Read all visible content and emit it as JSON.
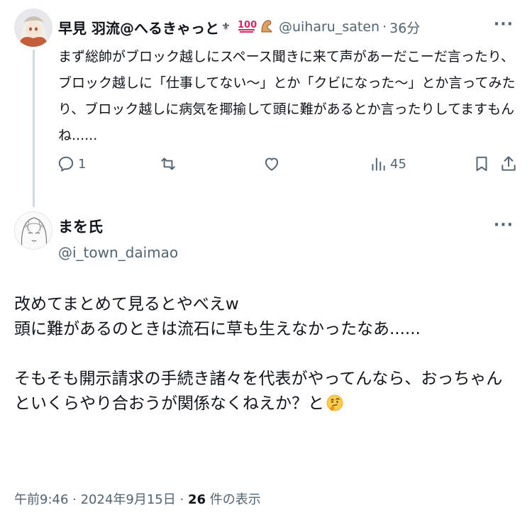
{
  "reply": {
    "name": "早見 羽流@へるきゃっと",
    "emojis": [
      "badge-emoji",
      "hundred-points-emoji",
      "arm-emoji"
    ],
    "handle": "@uiharu_saten",
    "separator": "·",
    "time": "36分",
    "more": "···",
    "text": "まず総帥がブロック越しにスペース聞きに来て声があーだこーだ言ったり、ブロック越しに「仕事してない〜」とか「クビになった〜」とか言ってみたり、ブロック越しに病気を揶揄して頭に難があるとか言ったりしてますもんね......",
    "actions": {
      "reply_count": "1",
      "retweet_count": "",
      "like_count": "",
      "views_count": "45"
    }
  },
  "main": {
    "name": "まを氏",
    "handle": "@i_town_daimao",
    "more": "···",
    "text": "改めてまとめて見るとやべえw\n頭に難があるのときは流石に草も生えなかったなあ......\n\nそもそも開示請求の手続き諸々を代表がやってんなら、おっちゃんといくらやり合おうが関係なくねえか？と",
    "trailing_emoji": "thinking-face-emoji"
  },
  "meta": {
    "time": "午前9:46",
    "sep1": " · ",
    "date": "2024年9月15日",
    "sep2": " · ",
    "views": "26",
    "views_label": " 件の表示"
  },
  "colors": {
    "text": "#0f1419",
    "secondary": "#536471",
    "thread_line": "#cfd9de",
    "hundred": "#e0245e"
  }
}
